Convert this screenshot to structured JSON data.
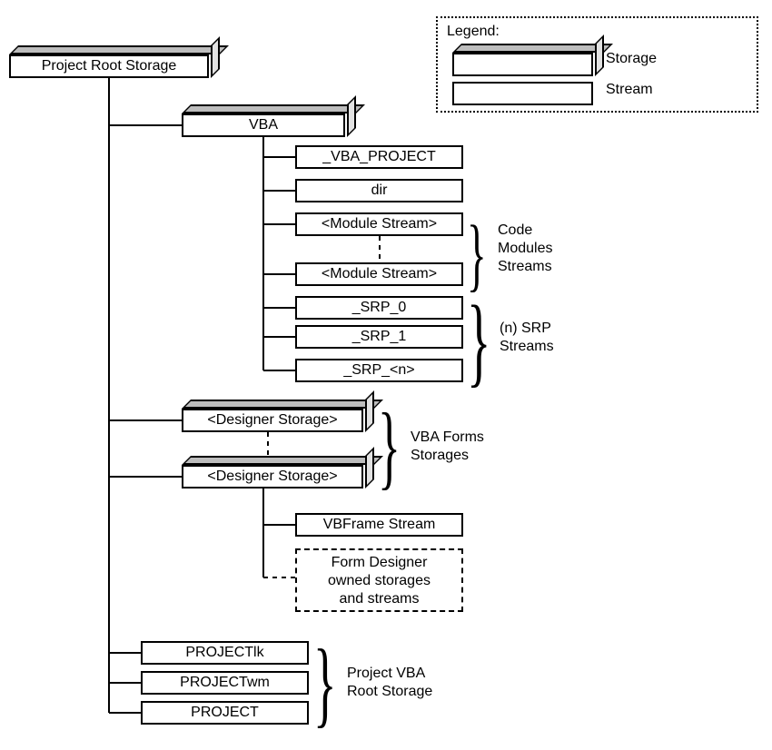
{
  "legend": {
    "title": "Legend:",
    "storage": "Storage",
    "stream": "Stream"
  },
  "root": {
    "label": "Project Root Storage"
  },
  "vba": {
    "label": "VBA",
    "children": {
      "vbaproject": "_VBA_PROJECT",
      "dir": "dir",
      "module1": "<Module Stream>",
      "module2": "<Module Stream>",
      "srp0": "_SRP_0",
      "srp1": "_SRP_1",
      "srpn": "_SRP_<n>"
    },
    "braces": {
      "code_modules": "Code\nModules\nStreams",
      "srp": "(n) SRP\nStreams"
    }
  },
  "designers": {
    "storage1": "<Designer Storage>",
    "storage2": "<Designer Storage>",
    "brace_label": "VBA Forms\nStorages",
    "vbframe": "VBFrame Stream",
    "owned": "Form Designer\nowned storages\nand streams"
  },
  "root_streams": {
    "projectlk": "PROJECTlk",
    "projectwm": "PROJECTwm",
    "project": "PROJECT"
  },
  "root_brace": "Project VBA\nRoot Storage"
}
